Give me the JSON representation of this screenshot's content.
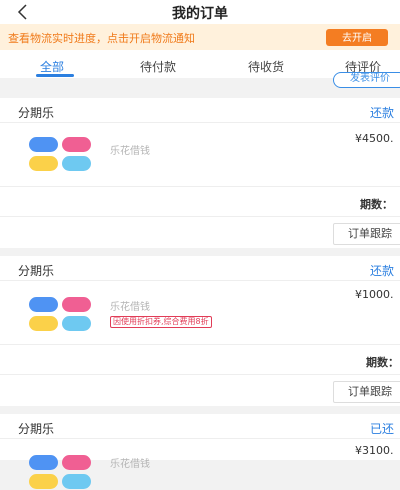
{
  "header": {
    "title": "我的订单",
    "back_icon": "chevron-left-icon"
  },
  "notice": {
    "text": "查看物流实时进度，点击开启物流通知",
    "button_label": "去开启"
  },
  "tabs": [
    {
      "label": "全部",
      "active": true
    },
    {
      "label": "待付款",
      "active": false
    },
    {
      "label": "待收货",
      "active": false
    },
    {
      "label": "待评价",
      "active": false
    }
  ],
  "floating_button": {
    "label": "发表评价"
  },
  "orders": [
    {
      "provider": "分期乐",
      "status": "还款",
      "product": "乐花借钱",
      "price": "¥4500.",
      "periods_label": "期数：",
      "track_label": "订单跟踪",
      "discount_tag": ""
    },
    {
      "provider": "分期乐",
      "status": "还款",
      "product": "乐花借钱",
      "price": "¥1000.",
      "periods_label": "期数：",
      "track_label": "订单跟踪",
      "discount_tag": "因使用折扣券,综合费用8折"
    },
    {
      "provider": "分期乐",
      "status": "已还",
      "product": "乐花借钱",
      "price": "¥3100.",
      "periods_label": "",
      "track_label": "",
      "discount_tag": ""
    }
  ],
  "colors": {
    "accent": "#2b7fe0",
    "notice_bg": "#fff1dc",
    "notice_text": "#f07a1a",
    "logo_blue": "#4f93f3",
    "logo_pink": "#f05f93",
    "logo_yellow": "#fbd149",
    "logo_cyan": "#6ec9f1"
  }
}
